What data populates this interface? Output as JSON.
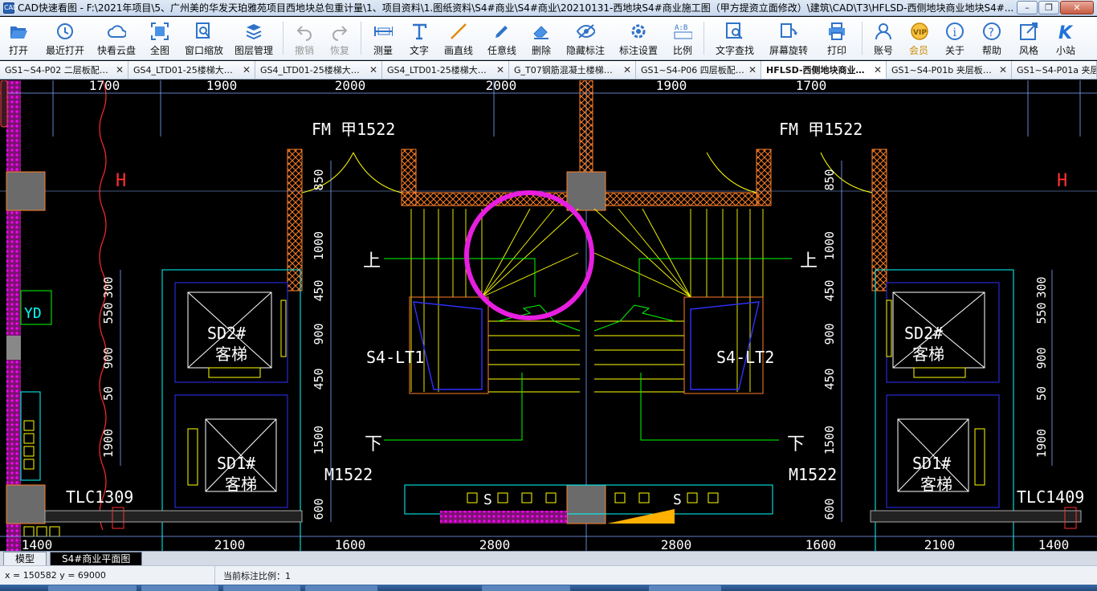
{
  "window": {
    "app_icon": "CAD",
    "title": "CAD快速看图 - F:\\2021年项目\\5、广州美的华发天珀雅苑项目西地块总包重计量\\1、项目资料\\1.图纸资料\\S4#商业\\S4#商业\\20210131-西地块S4#商业施工图（甲方提资立面修改）\\建筑\\CAD\\T3\\HFLSD-西侧地块商业地块S4#...",
    "min": "–",
    "restore": "❐",
    "close": "✕"
  },
  "toolbar": [
    {
      "label": "打开",
      "icon": "folder-open-icon"
    },
    {
      "label": "最近打开",
      "icon": "clock-history-icon"
    },
    {
      "label": "快看云盘",
      "icon": "cloud-icon"
    },
    {
      "label": "全图",
      "icon": "fit-all-icon"
    },
    {
      "label": "窗口缩放",
      "icon": "window-zoom-icon"
    },
    {
      "label": "图层管理",
      "icon": "layers-icon"
    },
    {
      "label": "撤销",
      "icon": "undo-icon",
      "disabled": true
    },
    {
      "label": "恢复",
      "icon": "redo-icon",
      "disabled": true
    },
    {
      "label": "测量",
      "icon": "measure-icon"
    },
    {
      "label": "文字",
      "icon": "text-icon"
    },
    {
      "label": "画直线",
      "icon": "line-icon"
    },
    {
      "label": "任意线",
      "icon": "freehand-icon"
    },
    {
      "label": "删除",
      "icon": "eraser-icon"
    },
    {
      "label": "隐藏标注",
      "icon": "eye-hide-icon"
    },
    {
      "label": "标注设置",
      "icon": "annotation-settings-icon"
    },
    {
      "label": "比例",
      "icon": "scale-icon"
    },
    {
      "label": "文字查找",
      "icon": "text-search-icon"
    },
    {
      "label": "屏幕旋转",
      "icon": "rotate-screen-icon"
    },
    {
      "label": "打印",
      "icon": "printer-icon"
    },
    {
      "label": "账号",
      "icon": "user-icon"
    },
    {
      "label": "会员",
      "icon": "vip-icon",
      "vip": true
    },
    {
      "label": "关于",
      "icon": "info-icon"
    },
    {
      "label": "帮助",
      "icon": "help-icon"
    },
    {
      "label": "风格",
      "icon": "style-icon"
    },
    {
      "label": "小站",
      "icon": "k-logo-icon"
    }
  ],
  "doc_tabs": [
    {
      "label": "GS1~S4-P02 二层板配…",
      "active": false
    },
    {
      "label": "GS4_LTD01-25楼梯大…",
      "active": false
    },
    {
      "label": "GS4_LTD01-25楼梯大…",
      "active": false
    },
    {
      "label": "GS4_LTD01-25楼梯大…",
      "active": false
    },
    {
      "label": "G_T07钢筋混凝土楼梯…",
      "active": false
    },
    {
      "label": "GS1~S4-P06 四层板配…",
      "active": false
    },
    {
      "label": "HFLSD-西侧地块商业…",
      "active": true
    },
    {
      "label": "GS1~S4-P01b 夹层板…",
      "active": false
    },
    {
      "label": "GS1~S4-P01a 夹层",
      "active": false
    }
  ],
  "tab_close": "✕",
  "drawing": {
    "dims_top": [
      "1700",
      "1900",
      "2000",
      "2000",
      "1900",
      "1700"
    ],
    "dims_bottom": [
      "1400",
      "2100",
      "1600",
      "2800",
      "2800",
      "1600",
      "2100",
      "1400"
    ],
    "left_vertical_dims": [
      "300",
      "550",
      "900",
      "50",
      "1900"
    ],
    "center_left_dims": [
      "850",
      "1000",
      "450",
      "900",
      "450",
      "1500",
      "600"
    ],
    "center_right_dims": [
      "850",
      "1000",
      "450",
      "900",
      "450",
      "1500",
      "600"
    ],
    "right_vertical_dims": [
      "300",
      "550",
      "900",
      "50",
      "1900"
    ],
    "door_top_left": "FM 甲1522",
    "door_top_right": "FM 甲1522",
    "stair_left": "S4-LT1",
    "stair_right": "S4-LT2",
    "up_left": "上",
    "up_right": "上",
    "down_left": "下",
    "down_right": "下",
    "door_bottom_left": "M1522",
    "door_bottom_right": "M1522",
    "elevator_sd2_left": "SD2#",
    "elevator_sd2_left_sub": "客梯",
    "elevator_sd1_left": "SD1#",
    "elevator_sd1_left_sub": "客梯",
    "elevator_sd2_right": "SD2#",
    "elevator_sd2_right_sub": "客梯",
    "elevator_sd1_right": "SD1#",
    "elevator_sd1_right_sub": "客梯",
    "window_left": "TLC1309",
    "window_right": "TLC1409",
    "axis_mark": "H",
    "yd_label": "YD",
    "s_mark": "S"
  },
  "layout_tabs": [
    {
      "label": "模型",
      "active": false
    },
    {
      "label": "S4#商业平面图",
      "active": true
    }
  ],
  "status": {
    "coords": "x = 150582  y = 69000",
    "scale": "当前标注比例：1"
  },
  "colors": {
    "wall": "#ff7f27",
    "yellow": "#ffff00",
    "cyan": "#00ffff",
    "green": "#00ff00",
    "magenta": "#ff00ff",
    "blue": "#0000ff",
    "white": "#ffffff",
    "highlight_circle": "#e81ee0"
  }
}
